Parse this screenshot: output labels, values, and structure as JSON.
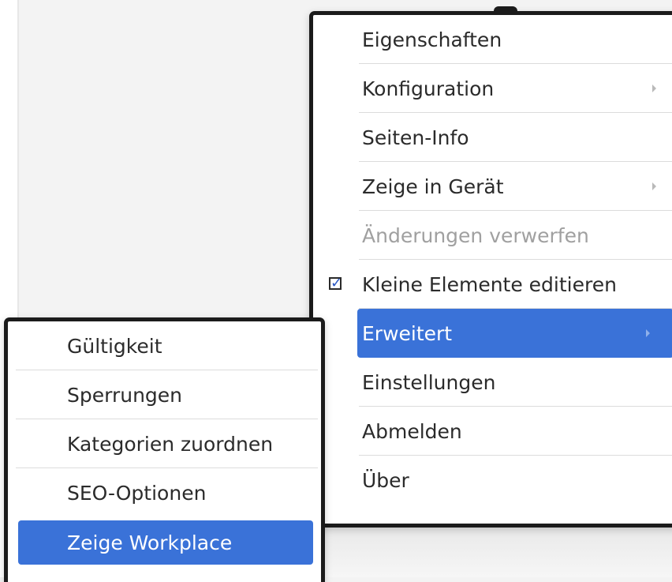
{
  "main_menu": {
    "items": [
      {
        "label": "Eigenschaften"
      },
      {
        "label": "Konfiguration",
        "submenu": true
      },
      {
        "label": "Seiten-Info"
      },
      {
        "label": "Zeige in Gerät",
        "submenu": true
      },
      {
        "label": "Änderungen verwerfen",
        "disabled": true
      },
      {
        "label": "Kleine Elemente editieren",
        "checked": true
      },
      {
        "label": "Erweitert",
        "submenu": true,
        "active": true
      },
      {
        "label": "Einstellungen"
      },
      {
        "label": "Abmelden"
      },
      {
        "label": "Über"
      }
    ]
  },
  "sub_menu": {
    "items": [
      {
        "label": "Gültigkeit"
      },
      {
        "label": "Sperrungen"
      },
      {
        "label": "Kategorien zuordnen"
      },
      {
        "label": "SEO-Optionen"
      },
      {
        "label": "Zeige Workplace",
        "active": true
      }
    ]
  },
  "colors": {
    "highlight": "#3a72d8",
    "text": "#2b2b2b",
    "disabled_text": "#a0a0a0",
    "border": "#1b1b1b"
  }
}
